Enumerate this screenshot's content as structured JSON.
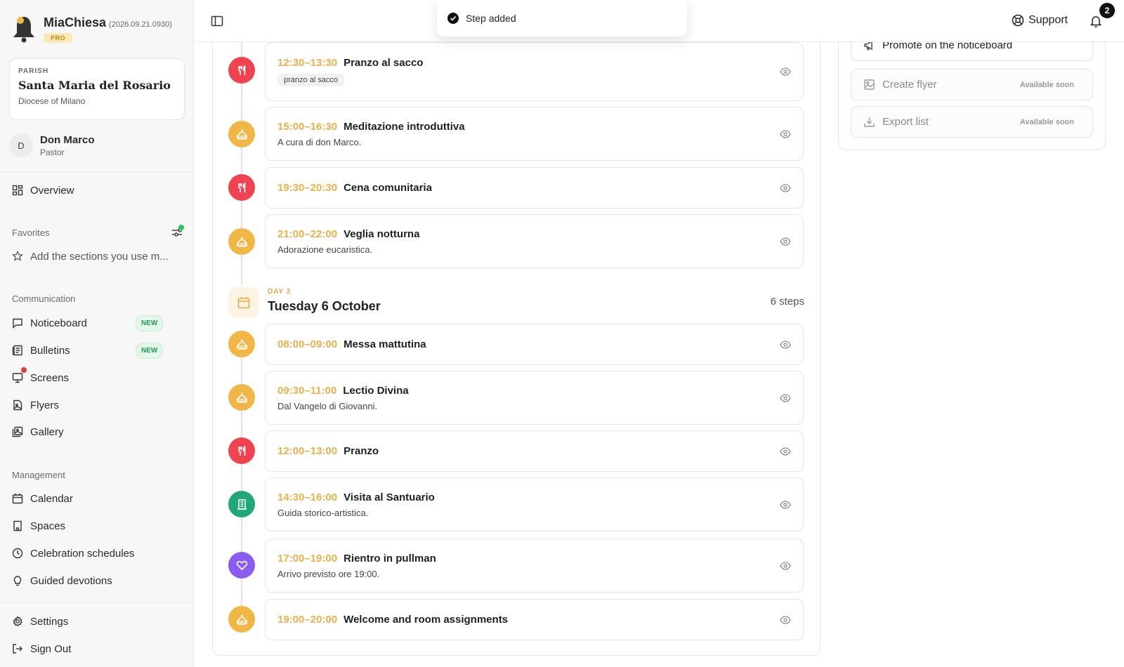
{
  "brand": {
    "name": "MiaChiesa",
    "version": "(2026.09.21.0930)",
    "plan": "PRO"
  },
  "parish": {
    "label": "PARISH",
    "name": "Santa Maria del Rosario",
    "diocese": "Diocese of Milano"
  },
  "user": {
    "initial": "D",
    "name": "Don Marco",
    "role": "Pastor"
  },
  "nav": {
    "overview": "Overview",
    "favorites_title": "Favorites",
    "favorites_hint": "Add the sections you use m...",
    "communication_title": "Communication",
    "noticeboard": "Noticeboard",
    "bulletins": "Bulletins",
    "screens": "Screens",
    "flyers": "Flyers",
    "gallery": "Gallery",
    "new_badge": "NEW",
    "management_title": "Management",
    "calendar": "Calendar",
    "spaces": "Spaces",
    "celebration_schedules": "Celebration schedules",
    "guided_devotions": "Guided devotions",
    "settings": "Settings",
    "sign_out": "Sign Out"
  },
  "topbar": {
    "support": "Support",
    "notifications_count": "2"
  },
  "toast": {
    "message": "Step added"
  },
  "day1_steps": [
    {
      "time": "12:30–13:30",
      "title": "Pranzo al sacco",
      "tag": "pranzo al sacco",
      "icon": "fork-knife-icon",
      "color": "#ef4350"
    },
    {
      "time": "15:00–16:30",
      "title": "Meditazione introduttiva",
      "desc": "A cura di don Marco.",
      "icon": "church-icon",
      "color": "#f0b646"
    },
    {
      "time": "19:30–20:30",
      "title": "Cena comunitaria",
      "icon": "fork-knife-icon",
      "color": "#ef4350"
    },
    {
      "time": "21:00–22:00",
      "title": "Veglia notturna",
      "desc": "Adorazione eucaristica.",
      "icon": "church-icon",
      "color": "#f0b646"
    }
  ],
  "day2": {
    "label": "DAY 2",
    "title": "Tuesday 6 October",
    "steps_count": "6 steps",
    "steps": [
      {
        "time": "08:00–09:00",
        "title": "Messa mattutina",
        "icon": "church-icon",
        "color": "#f0b646"
      },
      {
        "time": "09:30–11:00",
        "title": "Lectio Divina",
        "desc": "Dal Vangelo di Giovanni.",
        "icon": "church-icon",
        "color": "#f0b646"
      },
      {
        "time": "12:00–13:00",
        "title": "Pranzo",
        "icon": "fork-knife-icon",
        "color": "#ef4350"
      },
      {
        "time": "14:30–16:00",
        "title": "Visita al Santuario",
        "desc": "Guida storico-artistica.",
        "icon": "building-icon",
        "color": "#22a77a"
      },
      {
        "time": "17:00–19:00",
        "title": "Rientro in pullman",
        "desc": "Arrivo previsto ore 19:00.",
        "icon": "heart-icon",
        "color": "#8a5cf0"
      },
      {
        "time": "19:00–20:00",
        "title": "Welcome and room assignments",
        "icon": "church-icon",
        "color": "#f0b646"
      }
    ]
  },
  "actions": {
    "promote": "Promote on the noticeboard",
    "create_flyer": "Create flyer",
    "export_list": "Export list",
    "available_soon": "Available soon"
  }
}
